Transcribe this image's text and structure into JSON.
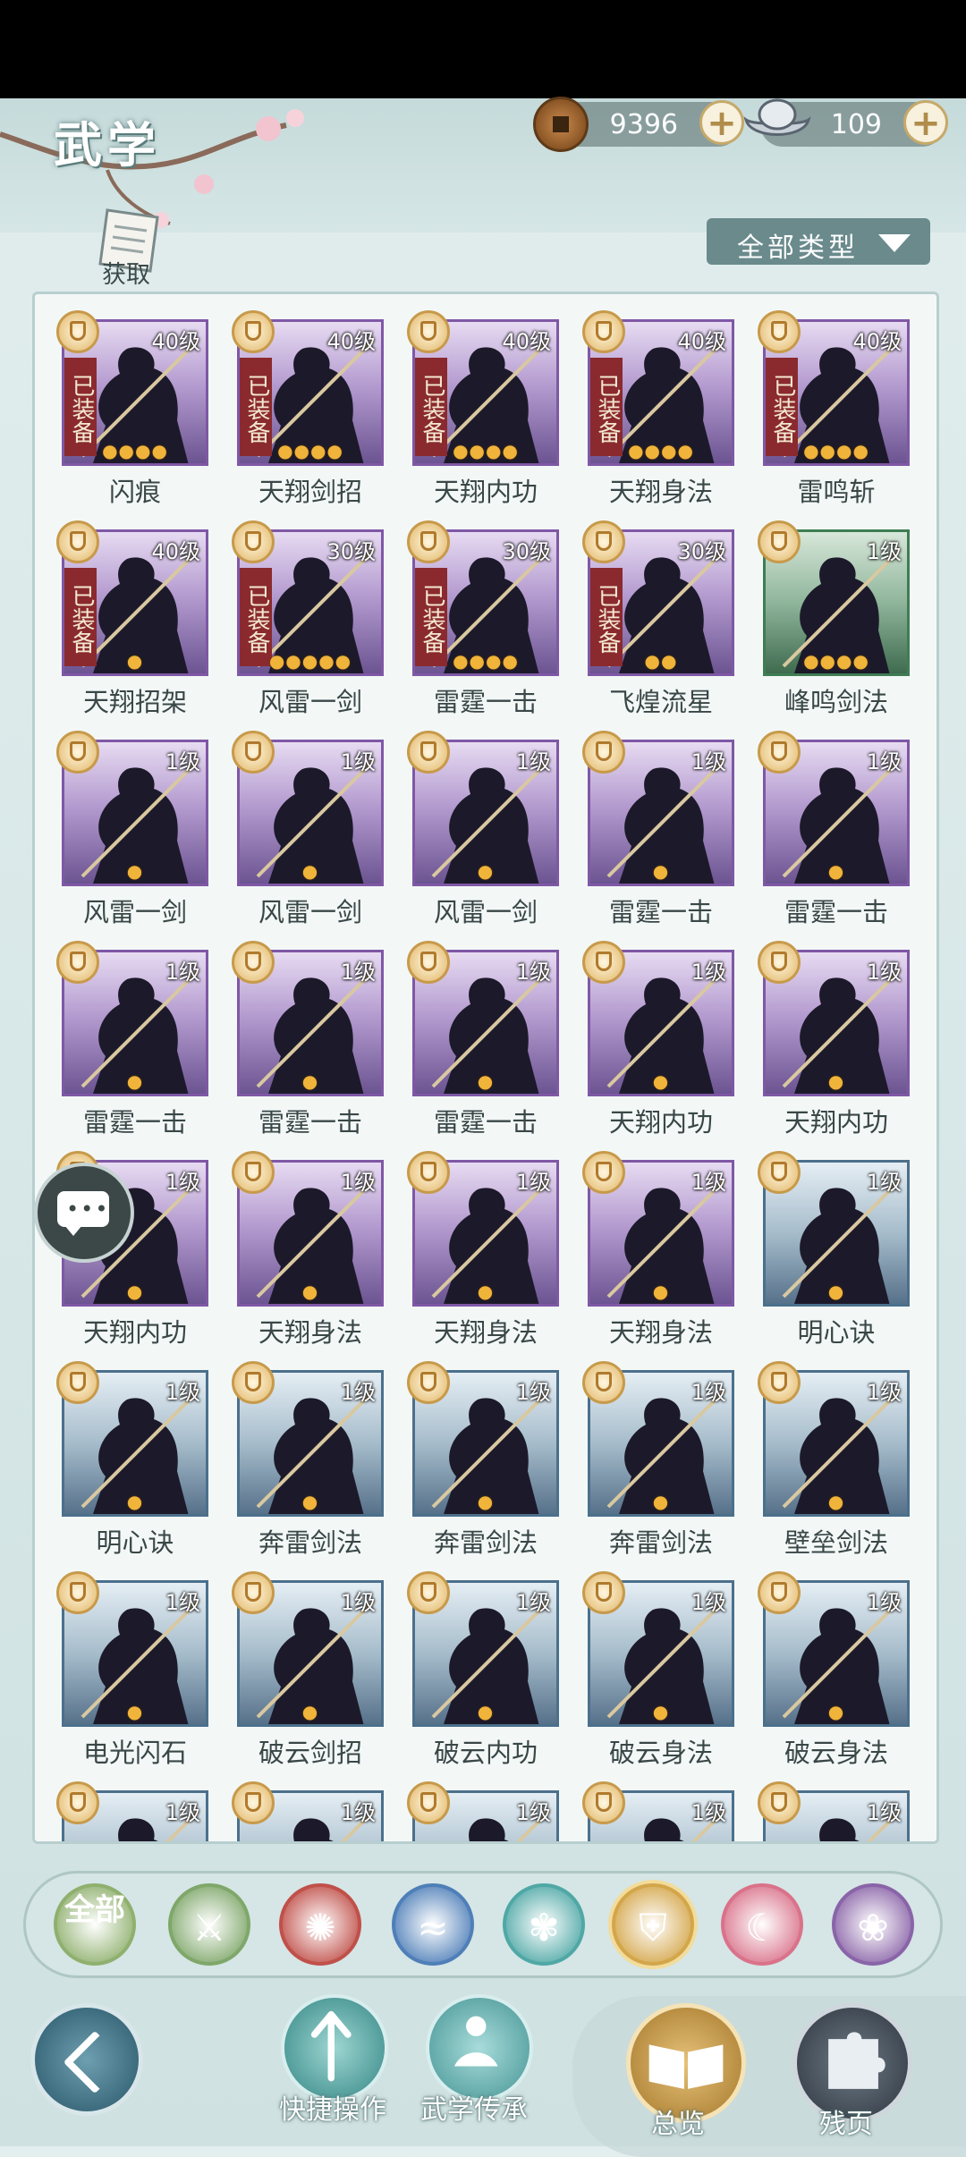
{
  "header": {
    "title": "武学",
    "acquire_label": "获取",
    "copper": {
      "value": "9396",
      "icon": "copper-coin-icon"
    },
    "silver": {
      "value": "109",
      "icon": "silver-ingot-icon"
    },
    "plus_label": "+"
  },
  "filter": {
    "label": "全部类型"
  },
  "skills": [
    {
      "name": "闪痕",
      "level": "40级",
      "equipped": true,
      "stars": 4,
      "rarity": "purple"
    },
    {
      "name": "天翔剑招",
      "level": "40级",
      "equipped": true,
      "stars": 4,
      "rarity": "purple"
    },
    {
      "name": "天翔内功",
      "level": "40级",
      "equipped": true,
      "stars": 4,
      "rarity": "purple"
    },
    {
      "name": "天翔身法",
      "level": "40级",
      "equipped": true,
      "stars": 4,
      "rarity": "purple"
    },
    {
      "name": "雷鸣斩",
      "level": "40级",
      "equipped": true,
      "stars": 4,
      "rarity": "purple"
    },
    {
      "name": "天翔招架",
      "level": "40级",
      "equipped": true,
      "stars": 1,
      "rarity": "purple"
    },
    {
      "name": "风雷一剑",
      "level": "30级",
      "equipped": true,
      "stars": 5,
      "rarity": "purple"
    },
    {
      "name": "雷霆一击",
      "level": "30级",
      "equipped": true,
      "stars": 4,
      "rarity": "purple"
    },
    {
      "name": "飞煌流星",
      "level": "30级",
      "equipped": true,
      "stars": 2,
      "rarity": "purple"
    },
    {
      "name": "峰鸣剑法",
      "level": "1级",
      "equipped": false,
      "stars": 4,
      "rarity": "green"
    },
    {
      "name": "风雷一剑",
      "level": "1级",
      "equipped": false,
      "stars": 1,
      "rarity": "purple"
    },
    {
      "name": "风雷一剑",
      "level": "1级",
      "equipped": false,
      "stars": 1,
      "rarity": "purple"
    },
    {
      "name": "风雷一剑",
      "level": "1级",
      "equipped": false,
      "stars": 1,
      "rarity": "purple"
    },
    {
      "name": "雷霆一击",
      "level": "1级",
      "equipped": false,
      "stars": 1,
      "rarity": "purple"
    },
    {
      "name": "雷霆一击",
      "level": "1级",
      "equipped": false,
      "stars": 1,
      "rarity": "purple"
    },
    {
      "name": "雷霆一击",
      "level": "1级",
      "equipped": false,
      "stars": 1,
      "rarity": "purple"
    },
    {
      "name": "雷霆一击",
      "level": "1级",
      "equipped": false,
      "stars": 1,
      "rarity": "purple"
    },
    {
      "name": "雷霆一击",
      "level": "1级",
      "equipped": false,
      "stars": 1,
      "rarity": "purple"
    },
    {
      "name": "天翔内功",
      "level": "1级",
      "equipped": false,
      "stars": 1,
      "rarity": "purple"
    },
    {
      "name": "天翔内功",
      "level": "1级",
      "equipped": false,
      "stars": 1,
      "rarity": "purple"
    },
    {
      "name": "天翔内功",
      "level": "1级",
      "equipped": false,
      "stars": 1,
      "rarity": "purple"
    },
    {
      "name": "天翔身法",
      "level": "1级",
      "equipped": false,
      "stars": 1,
      "rarity": "purple"
    },
    {
      "name": "天翔身法",
      "level": "1级",
      "equipped": false,
      "stars": 1,
      "rarity": "purple"
    },
    {
      "name": "天翔身法",
      "level": "1级",
      "equipped": false,
      "stars": 1,
      "rarity": "purple"
    },
    {
      "name": "明心诀",
      "level": "1级",
      "equipped": false,
      "stars": 1,
      "rarity": "blue"
    },
    {
      "name": "明心诀",
      "level": "1级",
      "equipped": false,
      "stars": 1,
      "rarity": "blue"
    },
    {
      "name": "奔雷剑法",
      "level": "1级",
      "equipped": false,
      "stars": 1,
      "rarity": "blue"
    },
    {
      "name": "奔雷剑法",
      "level": "1级",
      "equipped": false,
      "stars": 1,
      "rarity": "blue"
    },
    {
      "name": "奔雷剑法",
      "level": "1级",
      "equipped": false,
      "stars": 1,
      "rarity": "blue"
    },
    {
      "name": "壁垒剑法",
      "level": "1级",
      "equipped": false,
      "stars": 1,
      "rarity": "blue"
    },
    {
      "name": "电光闪石",
      "level": "1级",
      "equipped": false,
      "stars": 1,
      "rarity": "blue"
    },
    {
      "name": "破云剑招",
      "level": "1级",
      "equipped": false,
      "stars": 1,
      "rarity": "blue"
    },
    {
      "name": "破云内功",
      "level": "1级",
      "equipped": false,
      "stars": 1,
      "rarity": "blue"
    },
    {
      "name": "破云身法",
      "level": "1级",
      "equipped": false,
      "stars": 1,
      "rarity": "blue"
    },
    {
      "name": "破云身法",
      "level": "1级",
      "equipped": false,
      "stars": 1,
      "rarity": "blue"
    },
    {
      "name": "",
      "level": "1级",
      "equipped": false,
      "stars": 0,
      "rarity": "blue"
    },
    {
      "name": "",
      "level": "1级",
      "equipped": false,
      "stars": 0,
      "rarity": "blue"
    },
    {
      "name": "",
      "level": "1级",
      "equipped": false,
      "stars": 0,
      "rarity": "blue"
    },
    {
      "name": "",
      "level": "1级",
      "equipped": false,
      "stars": 0,
      "rarity": "blue"
    },
    {
      "name": "",
      "level": "1级",
      "equipped": false,
      "stars": 0,
      "rarity": "blue"
    }
  ],
  "equipped_label": "已装备",
  "categories": [
    {
      "id": "all",
      "label": "全部",
      "color": "#8fb06e",
      "icon": "all-category-icon"
    },
    {
      "id": "sword",
      "label": "",
      "color": "#7fa76a",
      "icon": "sword-category-icon"
    },
    {
      "id": "fire",
      "label": "",
      "color": "#c0504a",
      "icon": "flame-category-icon"
    },
    {
      "id": "wave",
      "label": "",
      "color": "#4f7fb8",
      "icon": "wave-category-icon"
    },
    {
      "id": "butterfly",
      "label": "",
      "color": "#4fa8a6",
      "icon": "butterfly-category-icon"
    },
    {
      "id": "shield",
      "label": "",
      "color": "#d4a64a",
      "icon": "shield-category-icon"
    },
    {
      "id": "moon",
      "label": "",
      "color": "#d9728a",
      "icon": "moon-category-icon"
    },
    {
      "id": "rose",
      "label": "",
      "color": "#8a64a8",
      "icon": "rose-category-icon"
    }
  ],
  "bottom_nav": {
    "quick_ops": "快捷操作",
    "inherit": "武学传承",
    "overview": "总览",
    "fragments": "残页"
  }
}
